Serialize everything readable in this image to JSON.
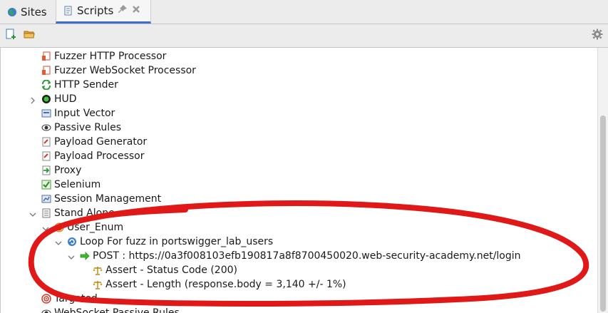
{
  "tabs": [
    {
      "label": "Sites",
      "icon": "globe-icon"
    },
    {
      "label": "Scripts",
      "icon": "scripts-icon"
    }
  ],
  "toolbar": {
    "new_script_icon": "new-script-icon",
    "load_script_icon": "load-script-icon",
    "options_icon": "gear-icon"
  },
  "tree": {
    "items": [
      {
        "label": "Fuzzer HTTP Processor",
        "icon": "fuzzer-http-icon"
      },
      {
        "label": "Fuzzer WebSocket Processor",
        "icon": "fuzzer-websocket-icon"
      },
      {
        "label": "HTTP Sender",
        "icon": "http-sender-icon"
      },
      {
        "label": "HUD",
        "icon": "hud-icon"
      },
      {
        "label": "Input Vector",
        "icon": "input-vector-icon"
      },
      {
        "label": "Passive Rules",
        "icon": "passive-rules-icon"
      },
      {
        "label": "Payload Generator",
        "icon": "payload-generator-icon"
      },
      {
        "label": "Payload Processor",
        "icon": "payload-processor-icon"
      },
      {
        "label": "Proxy",
        "icon": "proxy-icon"
      },
      {
        "label": "Selenium",
        "icon": "selenium-icon"
      },
      {
        "label": "Session Management",
        "icon": "session-management-icon"
      },
      {
        "label": "Stand Alone",
        "icon": "stand-alone-icon"
      },
      {
        "label": "User_Enum",
        "icon": "zest-script-icon"
      },
      {
        "label": "Loop For fuzz in portswigger_lab_users",
        "icon": "loop-icon"
      },
      {
        "label": "POST : https://0a3f008103efb190817a8f8700450020.web-security-academy.net/login",
        "icon": "request-arrow-icon"
      },
      {
        "label": "Assert - Status Code (200)",
        "icon": "scales-icon"
      },
      {
        "label": "Assert - Length (response.body = 3,140 +/- 1%)",
        "icon": "scales-icon"
      },
      {
        "label": "Targeted",
        "icon": "targeted-icon"
      },
      {
        "label": "WebSocket Passive Rules",
        "icon": "websocket-passive-icon"
      }
    ]
  },
  "colors": {
    "annotation": "#e01818",
    "selected_tab_underline": "#3d6ec9"
  }
}
